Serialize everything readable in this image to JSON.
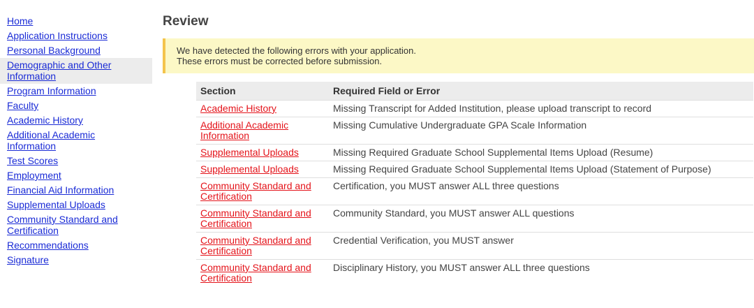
{
  "sidebar": {
    "items": [
      {
        "label": "Home",
        "active": false
      },
      {
        "label": "Application Instructions",
        "active": false
      },
      {
        "label": "Personal Background",
        "active": false
      },
      {
        "label": "Demographic and Other Information",
        "active": true
      },
      {
        "label": "Program Information",
        "active": false
      },
      {
        "label": "Faculty",
        "active": false
      },
      {
        "label": "Academic History",
        "active": false
      },
      {
        "label": "Additional Academic Information",
        "active": false
      },
      {
        "label": "Test Scores",
        "active": false
      },
      {
        "label": "Employment",
        "active": false
      },
      {
        "label": "Financial Aid Information",
        "active": false
      },
      {
        "label": "Supplemental Uploads",
        "active": false
      },
      {
        "label": "Community Standard and Certification",
        "active": false
      },
      {
        "label": "Recommendations",
        "active": false
      },
      {
        "label": "Signature",
        "active": false
      }
    ]
  },
  "main": {
    "title": "Review",
    "alert": {
      "line1": "We have detected the following errors with your application.",
      "line2": "These errors must be corrected before submission."
    },
    "table": {
      "headers": [
        "Section",
        "Required Field or Error"
      ],
      "rows": [
        {
          "section": "Academic History",
          "message": "Missing Transcript for Added Institution, please upload transcript to record"
        },
        {
          "section": "Additional Academic Information",
          "message": "Missing Cumulative Undergraduate GPA Scale Information"
        },
        {
          "section": "Supplemental Uploads",
          "message": "Missing Required Graduate School Supplemental Items Upload (Resume)"
        },
        {
          "section": "Supplemental Uploads",
          "message": "Missing Required Graduate School Supplemental Items Upload (Statement of Purpose)"
        },
        {
          "section": "Community Standard and Certification",
          "message": "Certification, you MUST answer ALL three questions"
        },
        {
          "section": "Community Standard and Certification",
          "message": "Community Standard, you MUST answer ALL questions"
        },
        {
          "section": "Community Standard and Certification",
          "message": "Credential Verification, you MUST answer"
        },
        {
          "section": "Community Standard and Certification",
          "message": "Disciplinary History, you MUST answer ALL three questions"
        }
      ]
    }
  },
  "colors": {
    "nav_link": "#1a2bd6",
    "section_link": "#e4131a",
    "alert_bg": "#fcf8c6",
    "alert_border": "#f4c44c",
    "header_bg": "#ececec"
  }
}
